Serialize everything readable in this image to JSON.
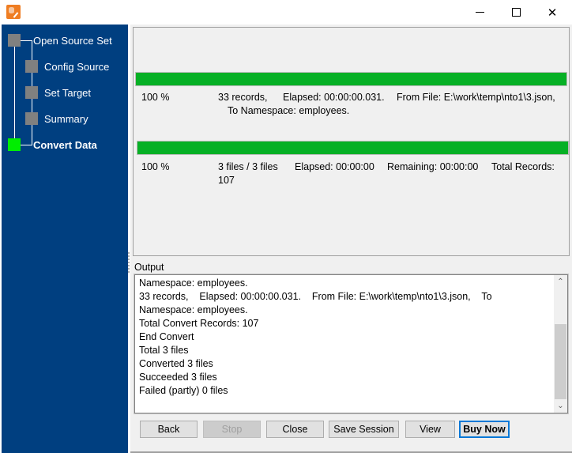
{
  "window": {
    "title": "",
    "icon": "app-database-edit-icon",
    "controls": {
      "minimize": "minimize-icon",
      "maximize": "maximize-icon",
      "close": "close-icon"
    }
  },
  "sidebar": {
    "steps": [
      {
        "label": "Open Source Set",
        "state": "done"
      },
      {
        "label": "Config Source",
        "state": "done"
      },
      {
        "label": "Set Target",
        "state": "done"
      },
      {
        "label": "Summary",
        "state": "done"
      },
      {
        "label": "Convert Data",
        "state": "active"
      }
    ],
    "colors": {
      "background": "#003f80",
      "done": "#808080",
      "active": "#00ee00"
    }
  },
  "progress": {
    "file": {
      "percent_value": 100,
      "percent_label": "100 %",
      "records": "33 records,",
      "elapsed": "Elapsed: 00:00:00.031.",
      "from_file": "From File: E:\\work\\temp\\nto1\\3.json,",
      "to_namespace": "To Namespace: employees."
    },
    "total": {
      "percent_value": 100,
      "percent_label": "100 %",
      "files": "3 files / 3 files",
      "elapsed": "Elapsed: 00:00:00",
      "remaining": "Remaining: 00:00:00",
      "total_records_label": "Total Records:",
      "total_records_value": "107"
    },
    "bar_color": "#06b025"
  },
  "output": {
    "label": "Output",
    "lines": [
      "Namespace: employees.",
      "33 records,    Elapsed: 00:00:00.031.    From File: E:\\work\\temp\\nto1\\3.json,    To",
      "Namespace: employees.",
      "Total Convert Records: 107",
      "End Convert",
      "Total 3 files",
      "Converted 3 files",
      "Succeeded 3 files",
      "Failed (partly) 0 files"
    ],
    "scroll_position": 0.55
  },
  "buttons": {
    "back": "Back",
    "stop": "Stop",
    "close": "Close",
    "save_session": "Save Session",
    "view": "View",
    "buy_now": "Buy Now"
  }
}
